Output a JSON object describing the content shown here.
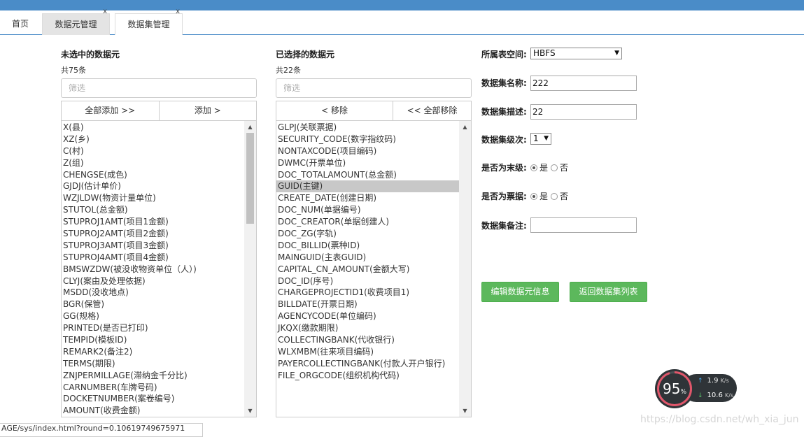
{
  "topbar": {
    "title": ""
  },
  "tabs": [
    {
      "label": "首页",
      "close": ""
    },
    {
      "label": "数据元管理",
      "close": "x"
    },
    {
      "label": "数据集管理",
      "close": "x"
    }
  ],
  "left_panel": {
    "title": "未选中的数据元",
    "count": "共75条",
    "filter_placeholder": "筛选",
    "add_all_label": "全部添加 >>",
    "add_label": "添加 >",
    "items": [
      "X(县)",
      "XZ(乡)",
      "C(村)",
      "Z(组)",
      "CHENGSE(成色)",
      "GJDJ(估计单价)",
      "WZJLDW(物资计量单位)",
      "STUTOL(总金额)",
      "STUPROJ1AMT(项目1金额)",
      "STUPROJ2AMT(项目2金额)",
      "STUPROJ3AMT(项目3金额)",
      "STUPROJ4AMT(项目4金额)",
      "BMSWZDW(被没收物资单位（人）)",
      "CLYJ(案由及处理依据)",
      "MSDD(没收地点)",
      "BGR(保管)",
      "GG(规格)",
      "PRINTED(是否已打印)",
      "TEMPID(模板ID)",
      "REMARK2(备注2)",
      "TERMS(期限)",
      "ZNJPERMILLAGE(滞纳金千分比)",
      "CARNUMBER(车牌号码)",
      "DOCKETNUMBER(案卷编号)",
      "AMOUNT(收费金额)"
    ],
    "scroll_up": "▲",
    "scroll_down": "▼"
  },
  "right_panel": {
    "title": "已选择的数据元",
    "count": "共22条",
    "filter_placeholder": "筛选",
    "remove_label": "< 移除",
    "remove_all_label": "<< 全部移除",
    "items": [
      "GLPJ(关联票据)",
      "SECURITY_CODE(数字指纹码)",
      "NONTAXCODE(项目编码)",
      "DWMC(开票单位)",
      "DOC_TOTALAMOUNT(总金额)",
      "GUID(主键)",
      "CREATE_DATE(创建日期)",
      "DOC_NUM(单据编号)",
      "DOC_CREATOR(单据创建人)",
      "DOC_ZG(字轨)",
      "DOC_BILLID(票种ID)",
      "MAINGUID(主表GUID)",
      "CAPITAL_CN_AMOUNT(金额大写)",
      "DOC_ID(序号)",
      "CHARGEPROJECTID1(收费项目1)",
      "BILLDATE(开票日期)",
      "AGENCYCODE(单位编码)",
      "JKQX(缴款期限)",
      "COLLECTINGBANK(代收银行)",
      "WLXMBM(往来项目编码)",
      "PAYERCOLLECTINGBANK(付款人开户银行)",
      "FILE_ORGCODE(组织机构代码)"
    ],
    "selected_index": 5,
    "scroll_up": "▲",
    "scroll_down": "▼"
  },
  "form": {
    "tablespace_label": "所属表空间:",
    "tablespace_value": "HBFS",
    "name_label": "数据集名称:",
    "name_value": "222",
    "desc_label": "数据集描述:",
    "desc_value": "22",
    "level_label": "数据集级次:",
    "level_value": "1",
    "is_leaf_label": "是否为末级:",
    "is_leaf_yes": "是",
    "is_leaf_no": "否",
    "is_bill_label": "是否为票据:",
    "is_bill_yes": "是",
    "is_bill_no": "否",
    "remark_label": "数据集备注:",
    "remark_value": "",
    "dropdown_caret": "▼",
    "edit_button": "编辑数据元信息",
    "back_button": "返回数据集列表"
  },
  "status_url": "AGE/sys/index.html?round=0.10619749675971",
  "net_monitor": {
    "usage_percent": "95",
    "percent_sign": "%",
    "usage_value": 95,
    "upload": "1.9",
    "upload_unit": "K/s",
    "download": "10.6",
    "download_unit": "K/s",
    "up_arrow": "↑",
    "down_arrow": "↓"
  },
  "watermark": "https://blog.csdn.net/wh_xia_jun",
  "colors": {
    "header": "#4a8cc8",
    "button_green": "#5cb85c",
    "selected_row": "#c8c8c8"
  }
}
